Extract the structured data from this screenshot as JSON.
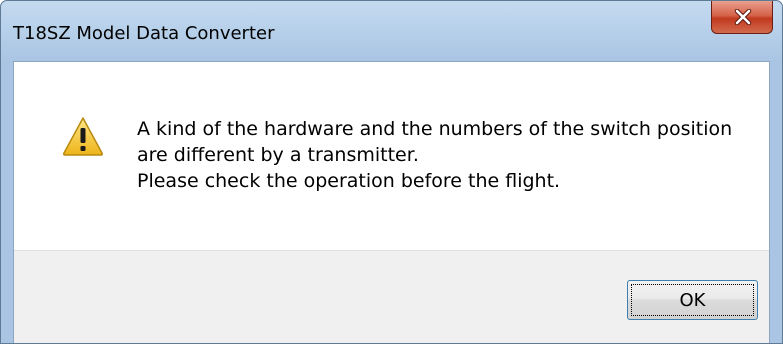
{
  "window": {
    "title": "T18SZ Model Data Converter",
    "close_icon": "close-icon"
  },
  "dialog": {
    "icon": "warning-icon",
    "message_lines": [
      "A kind of the hardware and the numbers of the switch position",
      "are different by a transmitter.",
      "Please check the operation before the flight."
    ],
    "ok_label": "OK"
  },
  "colors": {
    "close_button": "#c9462b",
    "warning_fill": "#f5c93a",
    "focus_border": "#3c7fb1"
  }
}
